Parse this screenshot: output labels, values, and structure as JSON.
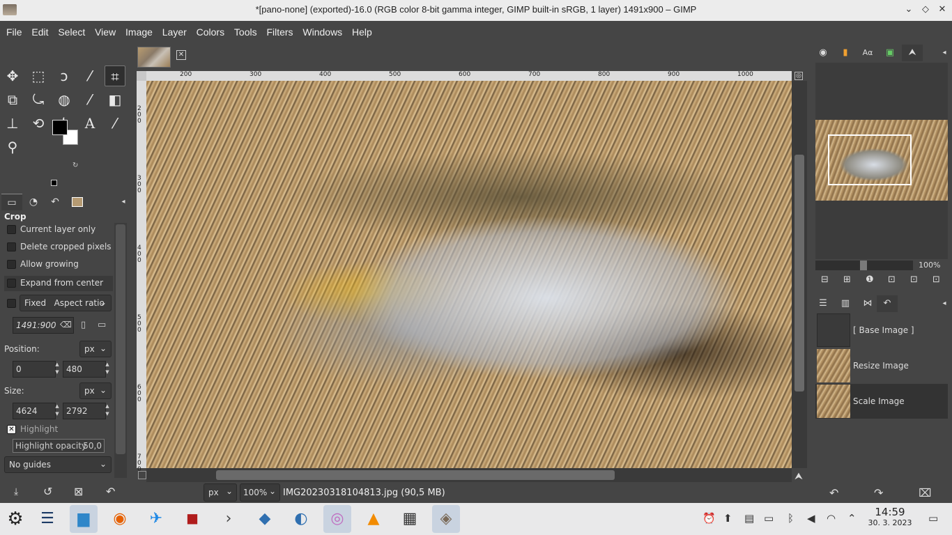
{
  "window": {
    "title": "*[pano-none] (exported)-16.0 (RGB color 8-bit gamma integer, GIMP built-in sRGB, 1 layer) 1491x900 – GIMP",
    "controls": [
      "minimize-icon",
      "maximize-icon",
      "close-icon"
    ]
  },
  "menu": [
    "File",
    "Edit",
    "Select",
    "View",
    "Image",
    "Layer",
    "Colors",
    "Tools",
    "Filters",
    "Windows",
    "Help"
  ],
  "tools": [
    "move-icon",
    "rect-select-icon",
    "lasso-icon",
    "fuzzy-select-icon",
    "crop-icon",
    "transform-icon",
    "warp-icon",
    "bucket-fill-icon",
    "paintbrush-icon",
    "eraser-icon",
    "clone-icon",
    "smudge-icon",
    "paths-icon",
    "text-icon",
    "color-picker-icon",
    "zoom-icon"
  ],
  "tool_glyphs": [
    "✥",
    "⬚",
    "ↄ",
    "⁄",
    "⌗",
    "⧉",
    "⤿",
    "◍",
    "⁄",
    "◧",
    "⊥",
    "⟲",
    "⌇",
    "A",
    "⁄",
    "⚲"
  ],
  "colors": {
    "foreground": "#000000",
    "background": "#ffffff"
  },
  "tool_options": {
    "title": "Crop",
    "current_layer_only": "Current layer only",
    "delete_cropped_pixels": "Delete cropped pixels",
    "allow_growing": "Allow growing",
    "expand_from_center": "Expand from center",
    "fixed_label": "Fixed",
    "fixed_mode": "Aspect ratio",
    "ratio_value": "1491:900",
    "position_label": "Position:",
    "position_unit": "px",
    "position_x": "0",
    "position_y": "480",
    "size_label": "Size:",
    "size_unit": "px",
    "size_w": "4624",
    "size_h": "2792",
    "highlight_label": "Highlight",
    "highlight_opacity_label": "Highlight opacity",
    "highlight_opacity_value": "50,0",
    "guides": "No guides"
  },
  "ruler": {
    "h_ticks": [
      "200",
      "300",
      "400",
      "500",
      "600",
      "700",
      "800",
      "900",
      "1000"
    ],
    "v_ticks": [
      "200",
      "300",
      "400",
      "500",
      "600",
      "700"
    ]
  },
  "status": {
    "unit": "px",
    "zoom": "100%",
    "file": "IMG20230318104813.jpg (90,5 MB)"
  },
  "navigator": {
    "zoom": "100%"
  },
  "history": [
    {
      "label": "[ Base Image ]",
      "selected": false
    },
    {
      "label": "Resize Image",
      "selected": false
    },
    {
      "label": "Scale Image",
      "selected": true
    }
  ],
  "taskbar": {
    "apps": [
      "app-launcher-icon",
      "system-settings-icon",
      "file-manager-icon",
      "firefox-icon",
      "browser-icon",
      "filezilla-icon",
      "terminal-icon",
      "fish-app-icon",
      "globe-app-icon",
      "disc-app-icon",
      "vlc-icon",
      "calculator-icon",
      "gimp-icon"
    ],
    "time": "14:59",
    "date": "30. 3. 2023"
  }
}
